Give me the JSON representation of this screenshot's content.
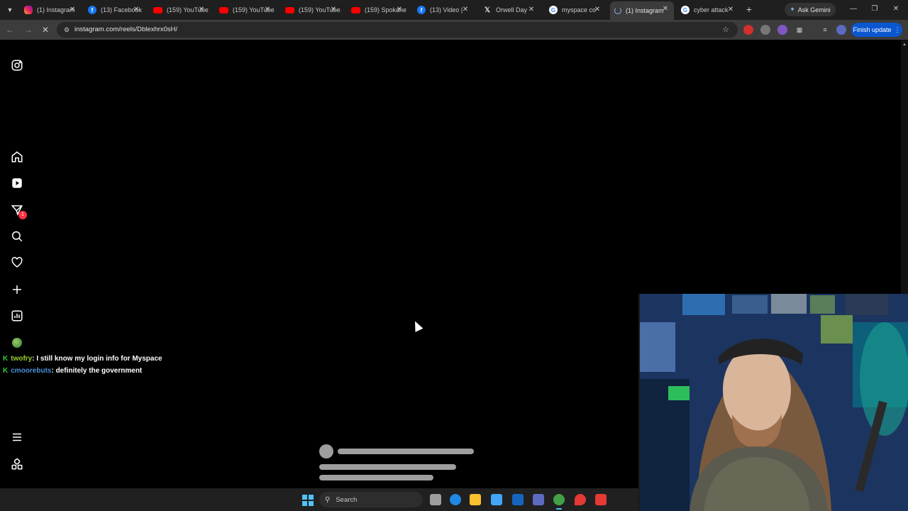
{
  "browser": {
    "tabs": [
      {
        "title": "(1) Instagram",
        "icon": "instagram-icon"
      },
      {
        "title": "(13) Facebook",
        "icon": "facebook-icon"
      },
      {
        "title": "(159) YouTube",
        "icon": "youtube-icon"
      },
      {
        "title": "(159) YouTube",
        "icon": "youtube-icon"
      },
      {
        "title": "(159) YouTube",
        "icon": "youtube-icon"
      },
      {
        "title": "(159) Spokane",
        "icon": "youtube-icon"
      },
      {
        "title": "(13) Video |",
        "icon": "facebook-icon"
      },
      {
        "title": "Orwell Day",
        "icon": "x-icon"
      },
      {
        "title": "myspace co",
        "icon": "google-icon"
      },
      {
        "title": "(1) Instagram",
        "icon": "loading-icon",
        "active": true
      },
      {
        "title": "cyber attack",
        "icon": "google-icon"
      }
    ],
    "ask_gemini": "Ask Gemini",
    "url": "instagram.com/reels/Dblexhrx0sH/",
    "finish_update": "Finish update"
  },
  "instagram": {
    "nav": [
      "instagram-logo-icon",
      "home-icon",
      "reels-icon",
      "messages-icon",
      "search-icon",
      "notifications-icon",
      "create-icon",
      "dashboard-icon",
      "profile-avatar",
      "menu-icon",
      "more-apps-icon"
    ],
    "messages_badge": "1"
  },
  "chat": [
    {
      "user": "twofry",
      "message": ": I still know my login info for Myspace"
    },
    {
      "user": "cmoorebuts",
      "message": ": definitely the government"
    }
  ],
  "taskbar": {
    "search_placeholder": "Search"
  },
  "colors": {
    "accent": "#0b57d0",
    "badge": "#ff3040",
    "chat_user1": "#9acd32",
    "chat_user2": "#4a90d9"
  }
}
